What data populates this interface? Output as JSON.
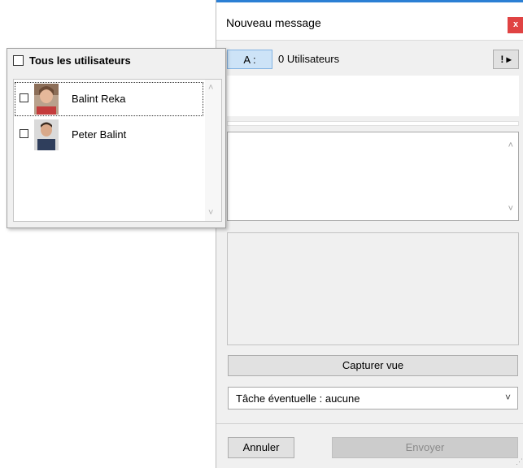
{
  "message_window": {
    "title": "Nouveau message",
    "close_glyph": "x",
    "to_label": "A :",
    "recipient_count": "0 Utilisateurs",
    "options_glyph": "! ▸",
    "body_scroll_up_glyph": "˄",
    "body_scroll_down_glyph": "˅",
    "capture_label": "Capturer vue",
    "task_select": {
      "value": "Tâche éventuelle : aucune",
      "chevron": "˅"
    },
    "cancel_label": "Annuler",
    "send_label": "Envoyer",
    "resize_grip": "⋰"
  },
  "users_panel": {
    "select_all_label": "Tous les utilisateurs",
    "scroll_up_glyph": "˄",
    "scroll_down_glyph": "˅",
    "users": [
      {
        "name": "Balint Reka",
        "selected": true
      },
      {
        "name": "Peter Balint",
        "selected": false
      }
    ]
  },
  "colors": {
    "accent_blue": "#2b7fd4",
    "to_button_bg": "#cde3f7",
    "close_red": "#e04343"
  },
  "icons": [
    "close-icon",
    "options-icon",
    "user-avatar",
    "chevron-down-icon",
    "resize-grip-icon"
  ]
}
